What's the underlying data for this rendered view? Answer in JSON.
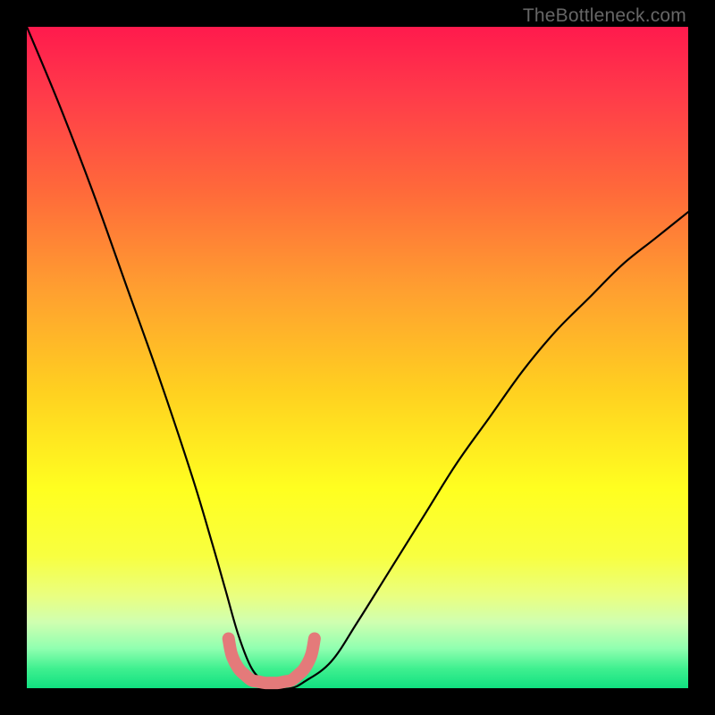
{
  "watermark": "TheBottleneck.com",
  "chart_data": {
    "type": "line",
    "title": "",
    "xlabel": "",
    "ylabel": "",
    "xlim": [
      0,
      100
    ],
    "ylim": [
      0,
      100
    ],
    "series": [
      {
        "name": "bottleneck-curve",
        "x": [
          0,
          5,
          10,
          15,
          20,
          25,
          28,
          30,
          32,
          34,
          36,
          38,
          40,
          42,
          46,
          50,
          55,
          60,
          65,
          70,
          75,
          80,
          85,
          90,
          95,
          100
        ],
        "values": [
          100,
          88,
          75,
          61,
          47,
          32,
          22,
          15,
          8,
          3,
          1,
          0,
          0,
          1,
          4,
          10,
          18,
          26,
          34,
          41,
          48,
          54,
          59,
          64,
          68,
          72
        ]
      },
      {
        "name": "sweet-spot-marker",
        "x": [
          30.5,
          31,
          32,
          33,
          34,
          35,
          36,
          37,
          38,
          39,
          40,
          41,
          42,
          43,
          43.5
        ],
        "values": [
          7.5,
          5,
          3,
          2,
          1.2,
          1,
          0.8,
          0.8,
          0.8,
          1,
          1.2,
          2,
          3,
          5,
          7.5
        ]
      }
    ],
    "annotations": []
  },
  "colors": {
    "curve": "#000000",
    "marker": "#e47a7a",
    "background_top": "#ff1a4d",
    "background_bottom": "#10e080"
  }
}
